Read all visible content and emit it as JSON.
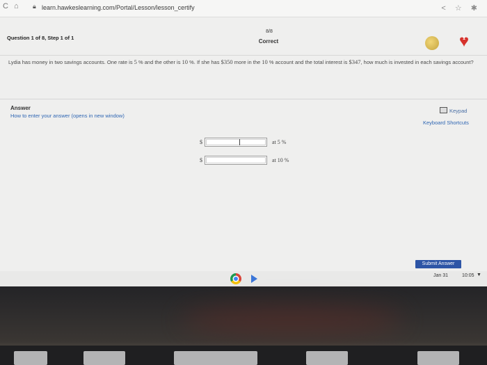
{
  "browser": {
    "url": "learn.hawkeslearning.com/Portal/Lesson/lesson_certify",
    "icons": [
      "back-icon",
      "reload-icon",
      "lock-icon",
      "share-icon",
      "star-icon",
      "extension-icon"
    ]
  },
  "question": {
    "label": "Question 1 of 8, Step 1 of 1",
    "score": "8/8",
    "status": "Correct",
    "hearts": "1",
    "text_parts": {
      "p1": "Lydia has money in two savings accounts. One rate is ",
      "rate1": "5",
      "p2": " % and the other is ",
      "rate2": "10",
      "p3": " %. If she has ",
      "more": "$350",
      "p4": " more in the ",
      "rate3": "10",
      "p5": " % account and the total interest is ",
      "interest": "$347",
      "p6": ", how much is invested in each savings account?"
    }
  },
  "answer": {
    "label": "Answer",
    "howto": "How to enter your answer (opens in new window)",
    "keypad": "Keypad",
    "shortcuts": "Keyboard Shortcuts",
    "rows": [
      {
        "currency": "$",
        "rate_label": "at 5 %"
      },
      {
        "currency": "$",
        "rate_label": "at 10 %"
      }
    ],
    "submit": "Submit Answer"
  },
  "shelf": {
    "date": "Jan 31",
    "time": "10:05"
  },
  "colors": {
    "link": "#2f66b3",
    "submit": "#2d55a6",
    "heart": "#d6322c",
    "coin": "#c5a43e"
  }
}
